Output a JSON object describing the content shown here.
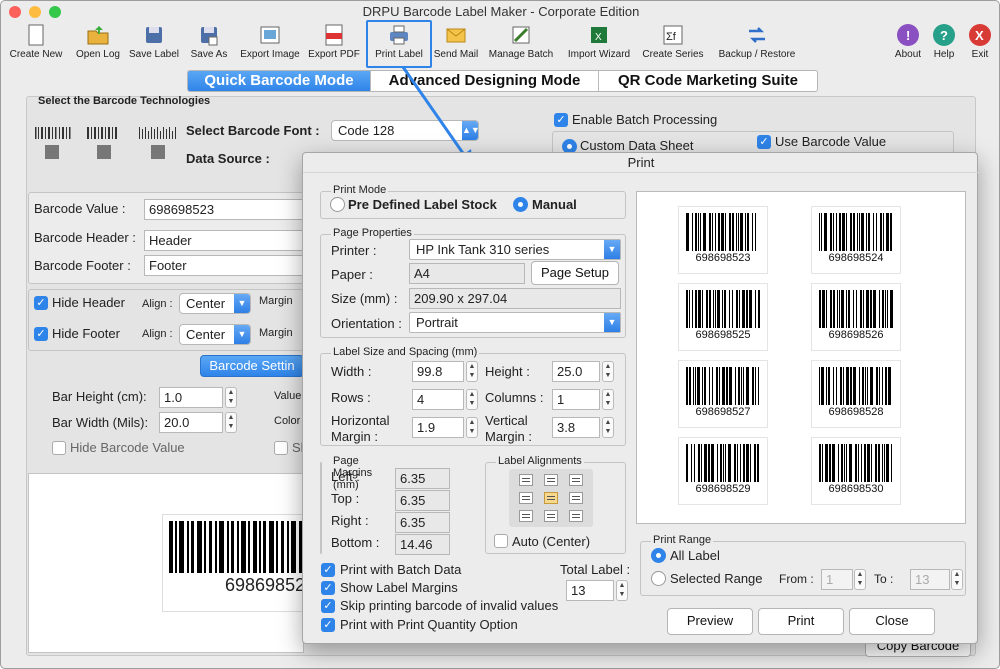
{
  "window": {
    "title": "DRPU Barcode Label Maker - Corporate Edition"
  },
  "toolbar": [
    {
      "label": "Create New",
      "icon": "create-new-icon"
    },
    {
      "label": "Open Log",
      "icon": "open-log-icon"
    },
    {
      "label": "Save Label",
      "icon": "save-label-icon"
    },
    {
      "label": "Save As",
      "icon": "save-as-icon"
    },
    {
      "label": "Export Image",
      "icon": "export-image-icon"
    },
    {
      "label": "Export PDF",
      "icon": "export-pdf-icon"
    },
    {
      "label": "Print Label",
      "icon": "print-label-icon"
    },
    {
      "label": "Send Mail",
      "icon": "send-mail-icon"
    },
    {
      "label": "Manage Batch",
      "icon": "manage-batch-icon"
    },
    {
      "label": "Import Wizard",
      "icon": "import-wizard-icon"
    },
    {
      "label": "Create Series",
      "icon": "create-series-icon"
    },
    {
      "label": "Backup / Restore",
      "icon": "backup-restore-icon"
    },
    {
      "label": "About",
      "icon": "about-icon"
    },
    {
      "label": "Help",
      "icon": "help-icon"
    },
    {
      "label": "Exit",
      "icon": "exit-icon"
    }
  ],
  "modes": {
    "quick": "Quick Barcode Mode",
    "advanced": "Advanced Designing Mode",
    "qr": "QR Code Marketing Suite"
  },
  "main": {
    "tech_title": "Select the Barcode Technologies",
    "font_label": "Select Barcode Font :",
    "font_value": "Code 128",
    "source_label": "Data Source :",
    "batch_label": "Enable Batch Processing",
    "custom_sheet": "Custom Data Sheet",
    "use_value": "Use Barcode Value",
    "value_label": "Barcode Value :",
    "value": "698698523",
    "header_label": "Barcode Header :",
    "header": "Header",
    "footer_label": "Barcode Footer :",
    "footer": "Footer",
    "hide_header": "Hide Header",
    "hide_footer": "Hide Footer",
    "align": "Align :",
    "align_value": "Center",
    "margin": "Margin",
    "settings_btn": "Barcode Settin",
    "bar_height_label": "Bar Height (cm):",
    "bar_height": "1.0",
    "bar_width_label": "Bar Width (Mils):",
    "bar_width": "20.0",
    "value_col": "Value",
    "color_col": "Color",
    "sh": "Sh",
    "hide_value": "Hide Barcode Value",
    "preview_num": "69869852",
    "copy_btn": "Copy Barcode"
  },
  "dialog": {
    "title": "Print",
    "print_mode": "Print Mode",
    "predefined": "Pre Defined Label Stock",
    "manual": "Manual",
    "page_props": "Page Properties",
    "printer_label": "Printer :",
    "printer": "HP Ink Tank 310 series",
    "paper_label": "Paper :",
    "paper": "A4",
    "page_setup": "Page Setup",
    "size_label": "Size (mm) :",
    "size": "209.90 x 297.04",
    "orient_label": "Orientation :",
    "orientation": "Portrait",
    "label_size": "Label Size and Spacing (mm)",
    "width_label": "Width :",
    "width": "99.8",
    "height_label": "Height :",
    "height": "25.0",
    "rows_label": "Rows :",
    "rows": "4",
    "cols_label": "Columns :",
    "cols": "1",
    "hmargin_label1": "Horizontal",
    "hmargin_label2": "Margin :",
    "hmargin": "1.9",
    "vmargin_label1": "Vertical",
    "vmargin_label2": "Margin :",
    "vmargin": "3.8",
    "page_margins": "Page Margins (mm)",
    "left_label": "Left :",
    "left": "6.35",
    "top_label": "Top :",
    "top": "6.35",
    "right_label": "Right :",
    "right": "6.35",
    "bottom_label": "Bottom :",
    "bottom": "14.46",
    "label_align": "Label Alignments",
    "auto_center": "Auto (Center)",
    "batch_data": "Print with Batch Data",
    "show_margins": "Show Label Margins",
    "skip_invalid": "Skip printing barcode of invalid values",
    "print_qty": "Print with Print Quantity Option",
    "total_label": "Total Label :",
    "total": "13",
    "print_range": "Print Range",
    "all_label": "All Label",
    "selected_range": "Selected Range",
    "from_label": "From :",
    "from": "1",
    "to_label": "To :",
    "to": "13",
    "preview_btn": "Preview",
    "print_btn": "Print",
    "close_btn": "Close",
    "barcodes": [
      "698698523",
      "698698524",
      "698698525",
      "698698526",
      "698698527",
      "698698528",
      "698698529",
      "698698530"
    ]
  }
}
